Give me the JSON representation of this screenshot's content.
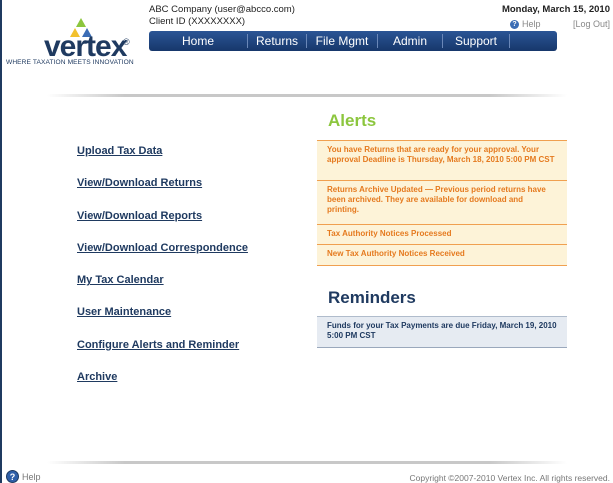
{
  "header": {
    "company_line": "ABC Company (user@abcco.com)",
    "client_line": "Client ID (XXXXXXXX)",
    "date": "Monday, March 15, 2010",
    "help_label": "Help",
    "logout_label": "[Log Out]"
  },
  "logo": {
    "word": "vertex",
    "registered": "®",
    "tagline": "WHERE TAXATION MEETS INNOVATION",
    "colors": {
      "navy": "#1f3a60",
      "green": "#8cc63e",
      "yellow": "#f2c12e",
      "blue": "#3b6db5"
    }
  },
  "nav": {
    "items": [
      "Home",
      "Returns",
      "File Mgmt",
      "Admin",
      "Support"
    ]
  },
  "menu": {
    "items": [
      "Upload Tax Data",
      "View/Download Returns",
      "View/Download Reports",
      "View/Download Correspondence",
      "My Tax Calendar",
      "User Maintenance",
      "Configure Alerts and Reminder",
      "Archive"
    ]
  },
  "alerts": {
    "title": "Alerts",
    "items": [
      "You have Returns that are ready for your approval. Your approval Deadline is Thursday, March 18, 2010 5:00 PM CST",
      "Returns Archive Updated — Previous period returns have been archived. They are available for download and printing.",
      "Tax Authority Notices Processed",
      "New Tax Authority Notices Received"
    ]
  },
  "reminders": {
    "title": "Reminders",
    "items": [
      "Funds for your Tax Payments are due Friday, March 19, 2010 5:00 PM CST"
    ]
  },
  "footer": {
    "help_label": "Help",
    "copyright": "Copyright ©2007-2010 Vertex Inc. All rights reserved."
  }
}
